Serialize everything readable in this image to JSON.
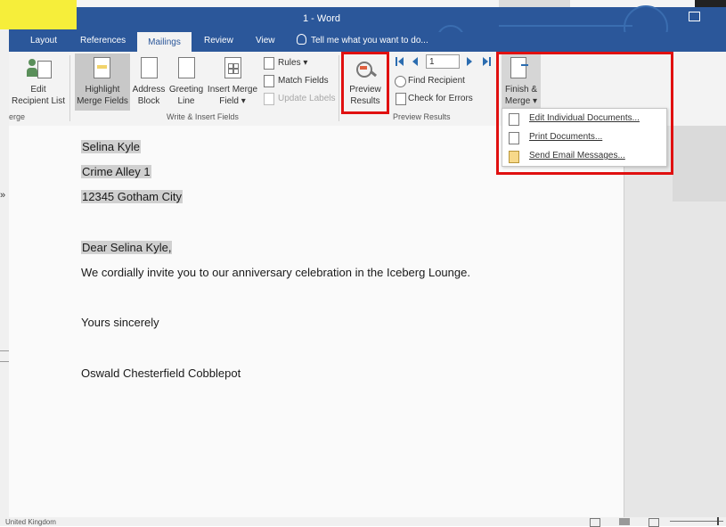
{
  "window": {
    "title": "1 - Word"
  },
  "tabs": {
    "layout": "Layout",
    "references": "References",
    "mailings": "Mailings",
    "review": "Review",
    "view": "View",
    "tell_me": "Tell me what you want to do..."
  },
  "ribbon": {
    "edit_recipient": {
      "line1": "Edit",
      "line2": "Recipient List"
    },
    "merge_partial": "erge",
    "highlight": {
      "line1": "Highlight",
      "line2": "Merge Fields"
    },
    "address_block": {
      "line1": "Address",
      "line2": "Block"
    },
    "greeting_line": {
      "line1": "Greeting",
      "line2": "Line"
    },
    "insert_merge_field": {
      "line1": "Insert Merge",
      "line2": "Field ▾"
    },
    "rules": "Rules ▾",
    "match_fields": "Match Fields",
    "update_labels": "Update Labels",
    "write_insert_group": "Write & Insert Fields",
    "preview_results": {
      "line1": "Preview",
      "line2": "Results"
    },
    "record_number": "1",
    "find_recipient": "Find Recipient",
    "check_errors": "Check for Errors",
    "preview_group": "Preview Results",
    "finish_merge": {
      "line1": "Finish &",
      "line2": "Merge ▾"
    }
  },
  "finish_menu": {
    "items": [
      "Edit Individual Documents...",
      "Print Documents...",
      "Send Email Messages..."
    ]
  },
  "document": {
    "address": [
      "Selina Kyle",
      "Crime Alley 1",
      "12345 Gotham City"
    ],
    "greeting": "Dear Selina Kyle,",
    "body": "We cordially invite you to our anniversary celebration in the Iceberg Lounge.",
    "closing": "Yours sincerely",
    "signature": "Oswald Chesterfield Cobblepot"
  },
  "statusbar": {
    "language": "United Kingdom"
  },
  "colors": {
    "word_blue": "#2b579a",
    "highlight_red": "#e01010"
  }
}
